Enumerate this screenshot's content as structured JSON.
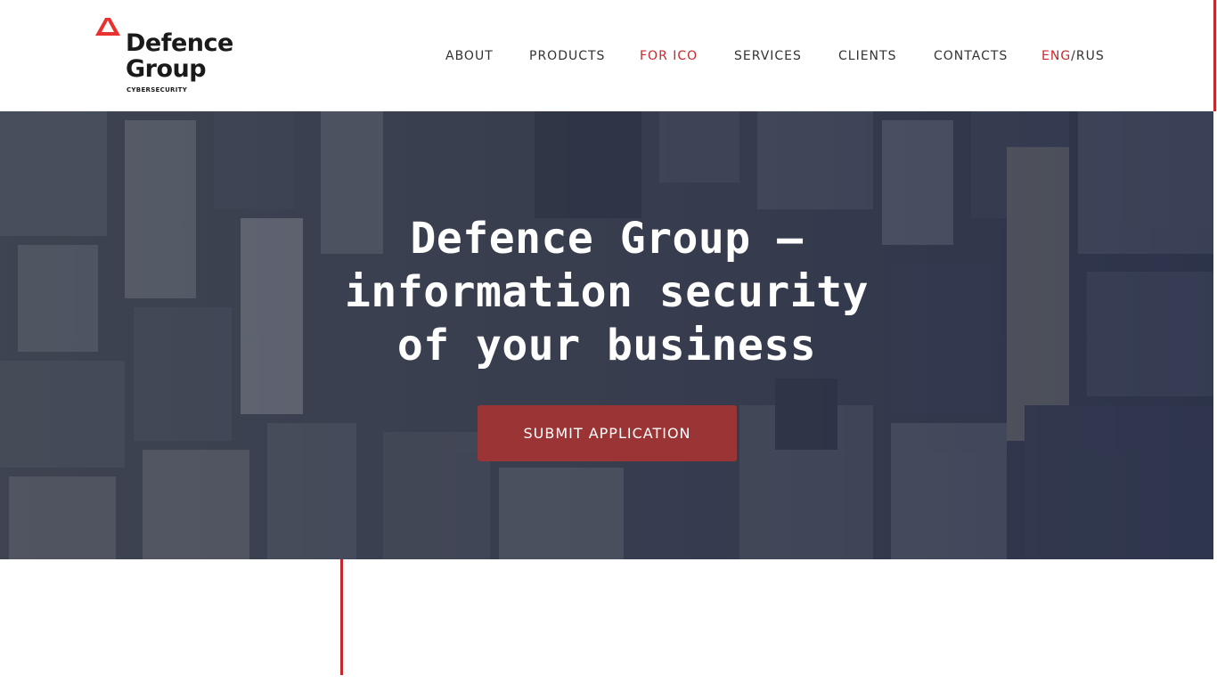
{
  "brand": {
    "name_line1": "Defence",
    "name_line2": "Group",
    "tagline": "CYBERSECURITY",
    "accent_color": "#c8272b"
  },
  "nav": {
    "items": [
      {
        "label": "ABOUT"
      },
      {
        "label": "PRODUCTS"
      },
      {
        "label": "FOR ICO",
        "active": true
      },
      {
        "label": "SERVICES"
      },
      {
        "label": "CLIENTS"
      },
      {
        "label": "CONTACTS"
      }
    ],
    "lang": {
      "eng": "ENG",
      "separator": "/",
      "rus": "RUS",
      "active": "ENG"
    }
  },
  "hero": {
    "title_lines": [
      "Defence Group –",
      "information security",
      "of your business"
    ],
    "cta_label": "SUBMIT APPLICATION",
    "cta_color": "#9b3434"
  },
  "icons": {
    "logo": "defence-group-logo-icon"
  }
}
